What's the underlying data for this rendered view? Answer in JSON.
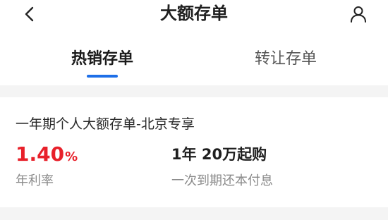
{
  "header": {
    "title": "大额存单",
    "back_icon": "chevron-left-icon",
    "user_icon": "user-icon"
  },
  "tabs": [
    {
      "label": "热销存单",
      "active": true
    },
    {
      "label": "转让存单",
      "active": false
    }
  ],
  "colors": {
    "accent": "#1e6fe8",
    "rate": "#e8202a",
    "muted": "#8a8a8a",
    "background_band": "#f4f4f4"
  },
  "product": {
    "name": "一年期个人大额存单-北京专享",
    "rate_value": "1.40",
    "rate_unit": "%",
    "rate_label": "年利率",
    "term": "1年 20万起购",
    "term_desc": "一次到期还本付息"
  }
}
